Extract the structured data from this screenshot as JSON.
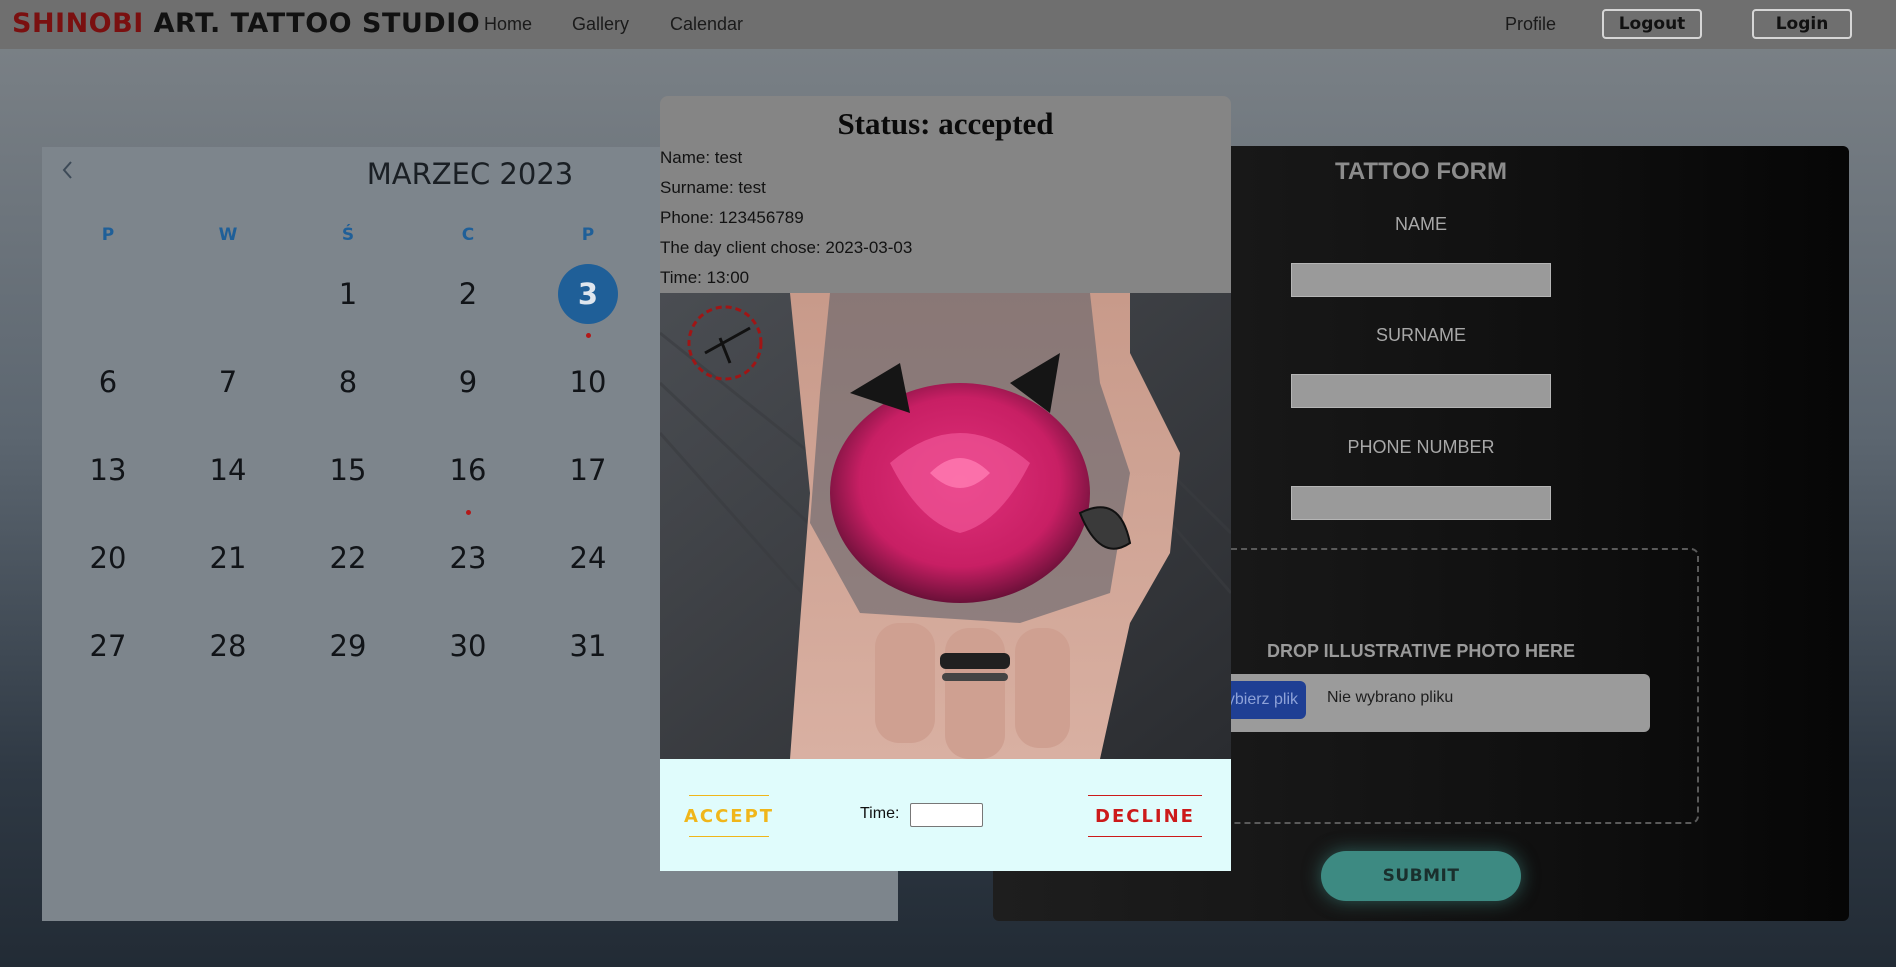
{
  "nav": {
    "brand_part1": "SHINOBI",
    "brand_part2": " ART. TATTOO STUDIO",
    "links": [
      "Home",
      "Gallery",
      "Calendar"
    ],
    "profile": "Profile",
    "logout": "Logout",
    "login": "Login"
  },
  "calendar": {
    "title": "MARZEC 2023",
    "prev_icon": "chevron-left-icon",
    "weekdays": [
      "P",
      "W",
      "Ś",
      "C",
      "P"
    ],
    "weeks": [
      [
        "",
        "",
        "1",
        "2",
        "3"
      ],
      [
        "6",
        "7",
        "8",
        "9",
        "10"
      ],
      [
        "13",
        "14",
        "15",
        "16",
        "17"
      ],
      [
        "20",
        "21",
        "22",
        "23",
        "24"
      ],
      [
        "27",
        "28",
        "29",
        "30",
        "31"
      ]
    ],
    "selected_day": "3",
    "days_with_events": [
      "3",
      "16"
    ],
    "accent_color": "#1f5f98",
    "event_dot_color": "#b31818"
  },
  "form": {
    "title": "TATTOO FORM",
    "name_label": "NAME",
    "surname_label": "SURNAME",
    "phone_label": "PHONE NUMBER",
    "drop_text": "DROP ILLUSTRATIVE PHOTO HERE",
    "file_button": "Wybierz plik",
    "file_name": "Nie wybrano pliku",
    "submit": "SUBMIT"
  },
  "modal": {
    "status": "Status: accepted",
    "name": "Name: test",
    "surname": "Surname: test",
    "phone": "Phone: 123456789",
    "day": "The day client chose: 2023-03-03",
    "time": "Time: 13:00",
    "accept": "ACCEPT",
    "time_label": "Time:",
    "time_value": "",
    "decline": "DECLINE"
  }
}
